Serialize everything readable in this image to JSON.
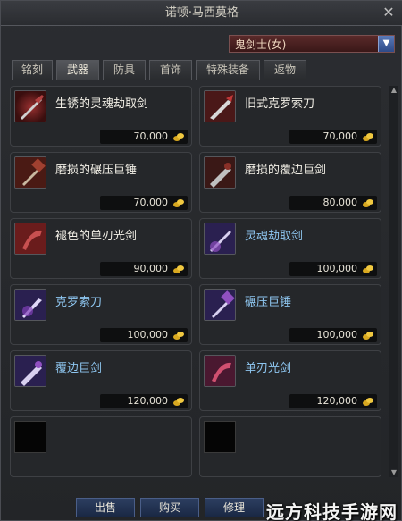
{
  "window": {
    "title": "诺顿·马西莫格"
  },
  "class_select": {
    "value": "鬼剑士(女)"
  },
  "tabs": [
    "铭刻",
    "武器",
    "防具",
    "首饰",
    "特殊装备",
    "返物"
  ],
  "active_tab": 1,
  "items": [
    {
      "name": "生锈的灵魂劫取剑",
      "price": "70,000",
      "color": "white"
    },
    {
      "name": "旧式克罗索刀",
      "price": "70,000",
      "color": "white"
    },
    {
      "name": "磨损的碾压巨锤",
      "price": "70,000",
      "color": "white"
    },
    {
      "name": "磨损的覆边巨剑",
      "price": "80,000",
      "color": "white"
    },
    {
      "name": "褪色的单刃光剑",
      "price": "90,000",
      "color": "white"
    },
    {
      "name": "灵魂劫取剑",
      "price": "100,000",
      "color": "blue"
    },
    {
      "name": "克罗索刀",
      "price": "100,000",
      "color": "blue"
    },
    {
      "name": "碾压巨锤",
      "price": "100,000",
      "color": "blue"
    },
    {
      "name": "覆边巨剑",
      "price": "120,000",
      "color": "blue"
    },
    {
      "name": "单刃光剑",
      "price": "120,000",
      "color": "blue"
    }
  ],
  "buttons": {
    "sell": "出售",
    "buy": "购买",
    "repair": "修理"
  },
  "watermark": "远方科技手游网",
  "colors": {
    "white_item": "#f2efe6",
    "blue_item": "#8ec6f0",
    "button": "#2c3e60"
  }
}
